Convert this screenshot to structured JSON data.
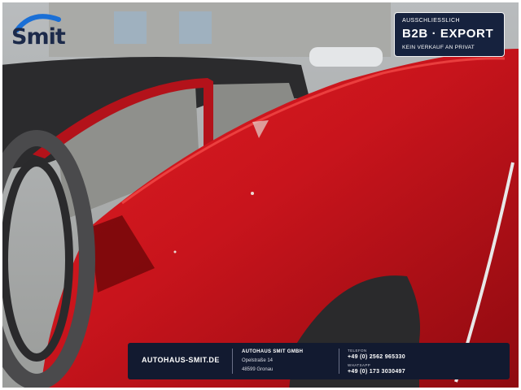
{
  "brand": {
    "logo_text": "Smit"
  },
  "badge": {
    "top": "AUSSCHLIESSLICH",
    "main": "B2B  ·  EXPORT",
    "bottom": "KEIN VERKAUF AN PRIVAT"
  },
  "footer": {
    "website": "AUTOHAUS-SMIT.DE",
    "company": "AUTOHAUS SMIT GMBH",
    "street": "Opelstraße 14",
    "city": "48599 Gronau",
    "phone_label": "TELEFON",
    "phone": "+49 (0) 2562 965330",
    "whatsapp_label": "WHATSAPP",
    "whatsapp": "+49 (0) 173 3030497"
  },
  "colors": {
    "navy": "#16223e",
    "car_red": "#c8141c",
    "logo_blue": "#1a6fd6"
  }
}
